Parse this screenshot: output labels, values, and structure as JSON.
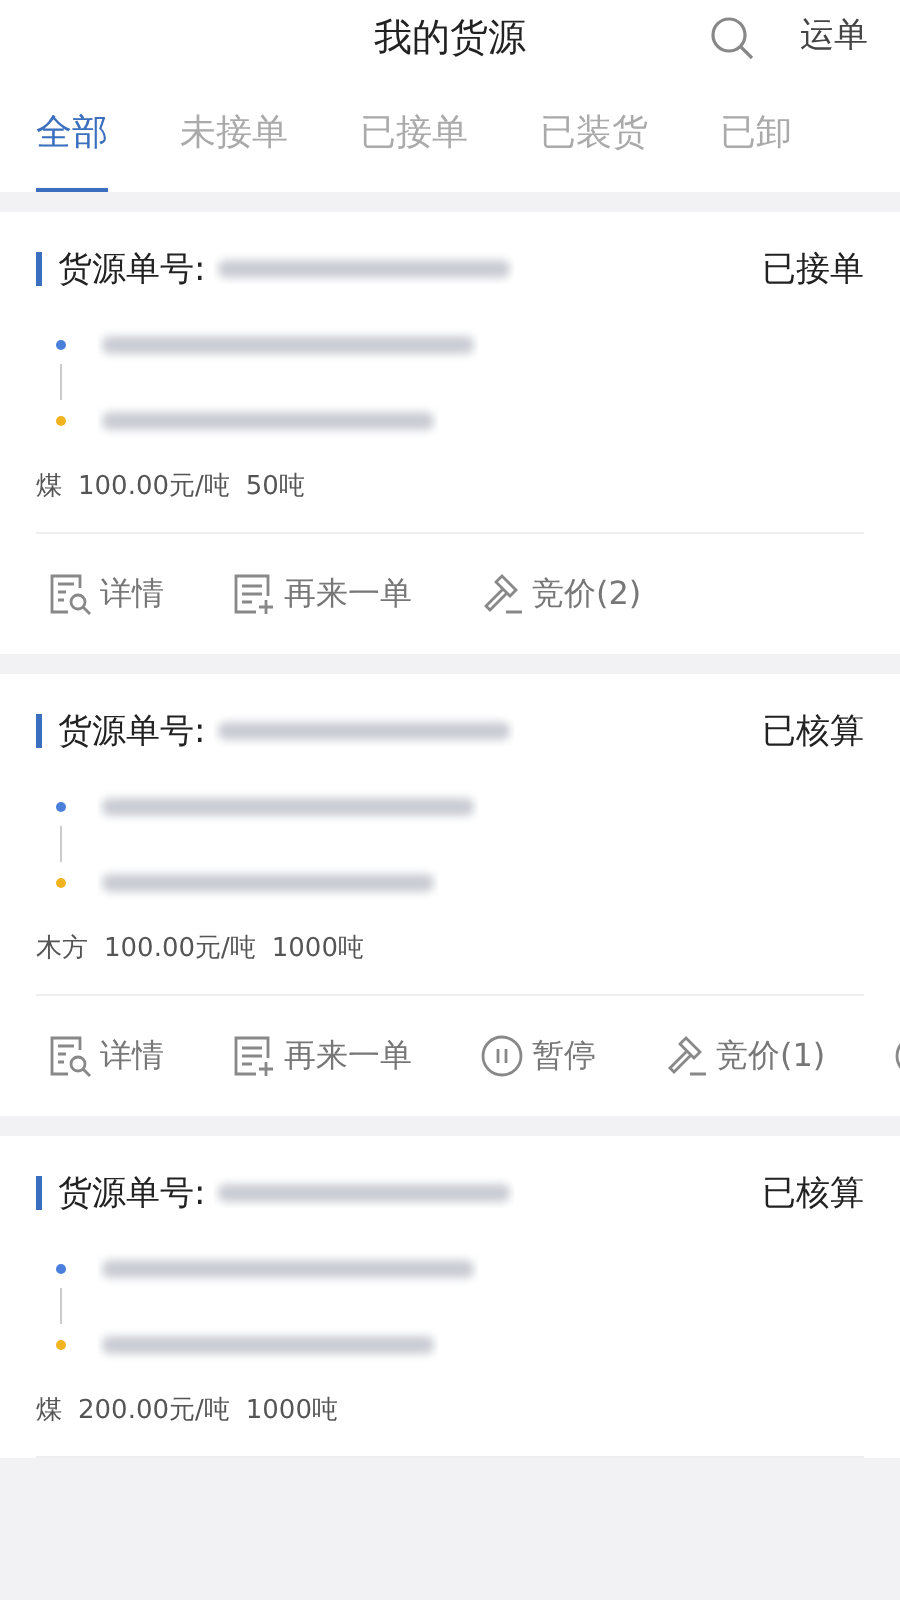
{
  "header": {
    "title": "我的货源",
    "action": "运单"
  },
  "tabs": [
    {
      "label": "全部",
      "selected": true
    },
    {
      "label": "未接单",
      "selected": false
    },
    {
      "label": "已接单",
      "selected": false
    },
    {
      "label": "已装货",
      "selected": false
    },
    {
      "label": "已卸",
      "selected": false
    }
  ],
  "cards": [
    {
      "order_label": "货源单号:",
      "status": "已接单",
      "cargo": "煤",
      "price": "100.00元/吨",
      "weight": "50吨",
      "actions": [
        {
          "kind": "detail",
          "label": "详情"
        },
        {
          "kind": "reorder",
          "label": "再来一单"
        },
        {
          "kind": "bid",
          "label": "竞价(2)"
        }
      ]
    },
    {
      "order_label": "货源单号:",
      "status": "已核算",
      "cargo": "木方",
      "price": "100.00元/吨",
      "weight": "1000吨",
      "actions": [
        {
          "kind": "detail",
          "label": "详情"
        },
        {
          "kind": "reorder",
          "label": "再来一单"
        },
        {
          "kind": "pause",
          "label": "暂停"
        },
        {
          "kind": "bid",
          "label": "竞价(1)"
        },
        {
          "kind": "circle"
        }
      ]
    },
    {
      "order_label": "货源单号:",
      "status": "已核算",
      "cargo": "煤",
      "price": "200.00元/吨",
      "weight": "1000吨"
    }
  ]
}
